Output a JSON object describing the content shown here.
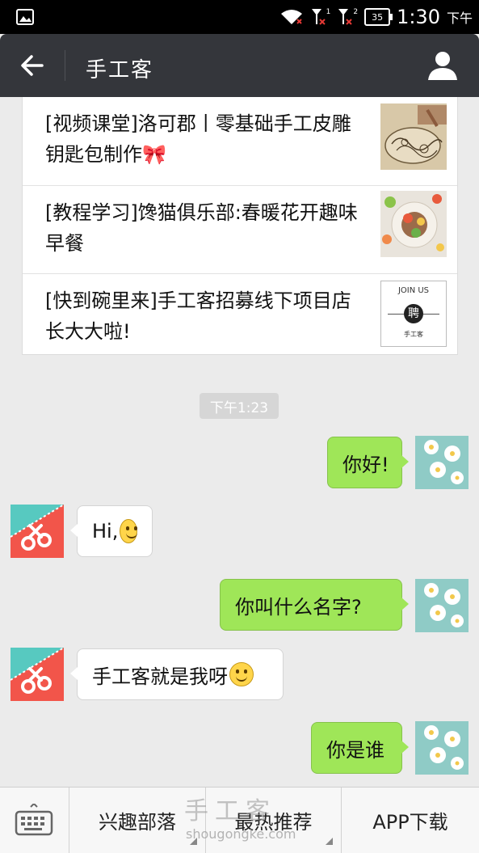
{
  "status_bar": {
    "battery": "35",
    "time": "1:30",
    "ampm": "下午",
    "sim1": "1",
    "sim2": "2"
  },
  "title_bar": {
    "title": "手工客"
  },
  "news": [
    {
      "text": "[视频课堂]洛可郡丨零基础手工皮雕钥匙包制作🎀",
      "thumb": "leather-carving"
    },
    {
      "text": "[教程学习]馋猫俱乐部:春暖花开趣味早餐",
      "thumb": "breakfast-plate"
    },
    {
      "text": "[快到碗里来]手工客招募线下项目店长大大啦!",
      "thumb": "join-us-logo"
    }
  ],
  "join_us": {
    "line1": "JOIN US",
    "mid": "聘",
    "line2": "手工客"
  },
  "timestamp": "下午1:23",
  "messages": [
    {
      "dir": "out",
      "text": "你好!"
    },
    {
      "dir": "in",
      "text": "Hi,"
    },
    {
      "dir": "out",
      "text": "你叫什么名字?"
    },
    {
      "dir": "in",
      "text": "手工客就是我呀"
    },
    {
      "dir": "out",
      "text": "你是谁"
    }
  ],
  "bottom_menu": {
    "item1": "兴趣部落",
    "item2": "最热推荐",
    "item3": "APP下载"
  },
  "watermark": {
    "text": "手工客",
    "url": "shougongke.com"
  },
  "colors": {
    "bubble_out": "#9fe658",
    "bubble_in": "#ffffff",
    "title_bar": "#34363b",
    "bot_avatar_bg": "#f2554a"
  }
}
